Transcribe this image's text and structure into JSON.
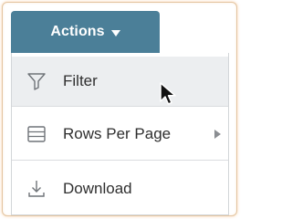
{
  "actions_menu": {
    "button_label": "Actions",
    "button_icon": "caret-down-icon",
    "button_color": "#4b7f98",
    "items": [
      {
        "label": "Filter",
        "icon": "filter-icon",
        "highlighted": true
      },
      {
        "label": "Rows Per Page",
        "icon": "rows-icon",
        "submenu_icon": "chevron-right-icon"
      },
      {
        "label": "Download",
        "icon": "download-icon"
      }
    ]
  },
  "pointer": {
    "icon": "cursor-icon"
  }
}
